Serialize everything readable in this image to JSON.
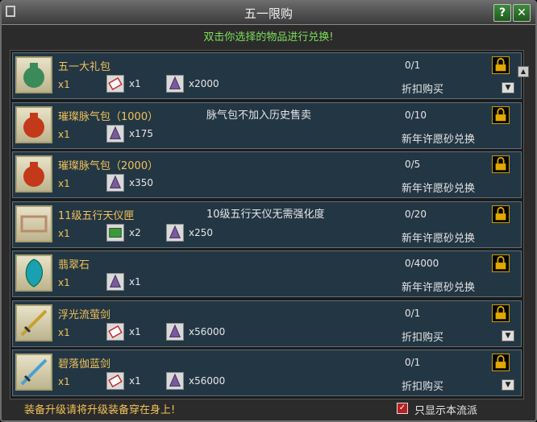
{
  "window": {
    "title": "五一限购",
    "help_label": "?",
    "close_label": "✕"
  },
  "subtitle": "双击你选择的物品进行兑换!",
  "items": [
    {
      "name": "五一大礼包",
      "qty": "x1",
      "costs": [
        {
          "icon": "ticket-icon",
          "text": "x1"
        },
        {
          "icon": "crystal-icon",
          "text": "x2000"
        }
      ],
      "note": "",
      "count": "0/1",
      "action": "折扣购买",
      "dropdown": true,
      "icon": "gift-bag-icon",
      "color": "#3a8a5a"
    },
    {
      "name": "璀璨脉气包（1000）",
      "qty": "x1",
      "costs": [
        {
          "icon": "crystal-icon",
          "text": "x175"
        }
      ],
      "note": "脉气包不加入历史售卖",
      "count": "0/10",
      "action": "新年许愿砂兑换",
      "dropdown": false,
      "icon": "red-pouch-icon",
      "color": "#c23a1a"
    },
    {
      "name": "璀璨脉气包（2000）",
      "qty": "x1",
      "costs": [
        {
          "icon": "crystal-icon",
          "text": "x350"
        }
      ],
      "note": "",
      "count": "0/5",
      "action": "新年许愿砂兑换",
      "dropdown": false,
      "icon": "red-pouch-icon",
      "color": "#c23a1a"
    },
    {
      "name": "11级五行天仪匣",
      "qty": "x1",
      "costs": [
        {
          "icon": "green-gem-icon",
          "text": "x2"
        },
        {
          "icon": "crystal-icon",
          "text": "x250"
        }
      ],
      "note": "10级五行天仪无需强化度",
      "count": "0/20",
      "action": "新年许愿砂兑换",
      "dropdown": false,
      "icon": "chest-icon",
      "color": "#b88c6a"
    },
    {
      "name": "翡翠石",
      "qty": "x1",
      "costs": [
        {
          "icon": "crystal-icon",
          "text": "x1"
        }
      ],
      "note": "",
      "count": "0/4000",
      "action": "新年许愿砂兑换",
      "dropdown": false,
      "icon": "jade-stone-icon",
      "color": "#1aa0b0"
    },
    {
      "name": "浮光流萤剑",
      "qty": "x1",
      "costs": [
        {
          "icon": "ticket-icon",
          "text": "x1"
        },
        {
          "icon": "crystal-icon",
          "text": "x56000"
        }
      ],
      "note": "",
      "count": "0/1",
      "action": "折扣购买",
      "dropdown": true,
      "icon": "sword-icon",
      "color": "#c8a030"
    },
    {
      "name": "碧落伽蓝剑",
      "qty": "x1",
      "costs": [
        {
          "icon": "ticket-icon",
          "text": "x1"
        },
        {
          "icon": "crystal-icon",
          "text": "x56000"
        }
      ],
      "note": "",
      "count": "0/1",
      "action": "折扣购买",
      "dropdown": true,
      "icon": "sword-icon",
      "color": "#4aa0d0"
    }
  ],
  "footer": {
    "warning": "装备升级请将升级装备穿在身上!",
    "checkbox_label": "只显示本流派",
    "checked": true
  }
}
